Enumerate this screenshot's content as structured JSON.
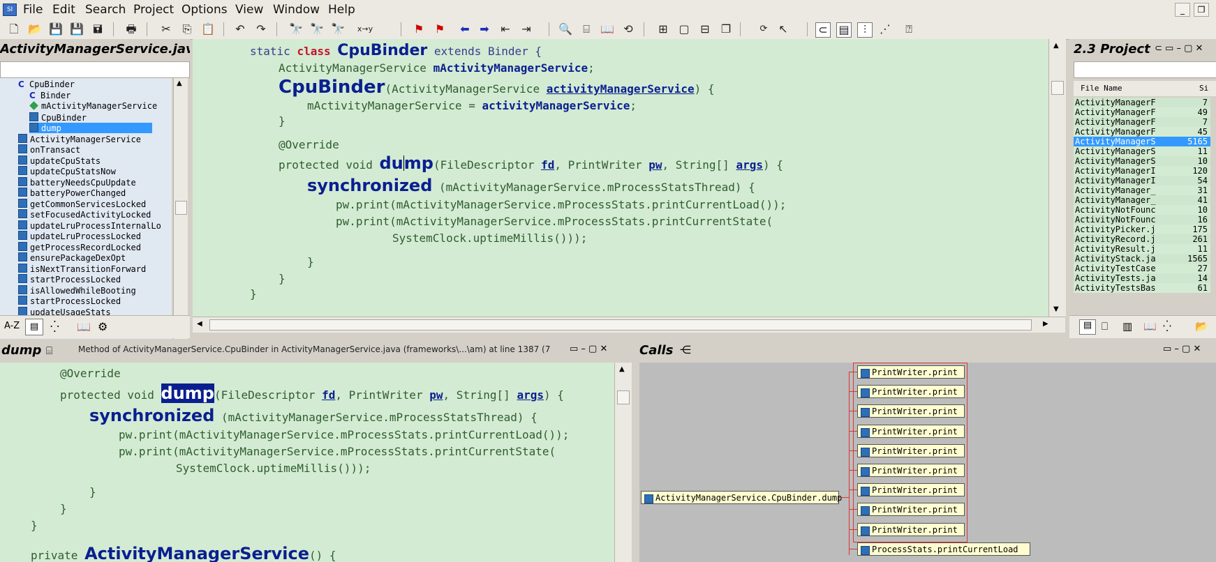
{
  "menubar": {
    "items": [
      "File",
      "Edit",
      "Search",
      "Project",
      "Options",
      "View",
      "Window",
      "Help"
    ]
  },
  "symbol_panel": {
    "title": "ActivityManagerService.java",
    "tree": [
      {
        "label": "CpuBinder",
        "icon": "class-icon",
        "indent": 1
      },
      {
        "label": "Binder",
        "icon": "class-icon",
        "indent": 2
      },
      {
        "label": "mActivityManagerService",
        "icon": "field-icon",
        "indent": 2
      },
      {
        "label": "CpuBinder",
        "icon": "method-icon",
        "indent": 2
      },
      {
        "label": "dump",
        "icon": "method-icon",
        "indent": 2,
        "selected": true
      },
      {
        "label": "ActivityManagerService",
        "icon": "method-icon",
        "indent": 1
      },
      {
        "label": "onTransact",
        "icon": "method-icon",
        "indent": 1
      },
      {
        "label": "updateCpuStats",
        "icon": "method-icon",
        "indent": 1
      },
      {
        "label": "updateCpuStatsNow",
        "icon": "method-icon",
        "indent": 1
      },
      {
        "label": "batteryNeedsCpuUpdate",
        "icon": "method-icon",
        "indent": 1
      },
      {
        "label": "batteryPowerChanged",
        "icon": "method-icon",
        "indent": 1
      },
      {
        "label": "getCommonServicesLocked",
        "icon": "method-icon",
        "indent": 1
      },
      {
        "label": "setFocusedActivityLocked",
        "icon": "method-icon",
        "indent": 1
      },
      {
        "label": "updateLruProcessInternalLo",
        "icon": "method-icon",
        "indent": 1
      },
      {
        "label": "updateLruProcessLocked",
        "icon": "method-icon",
        "indent": 1
      },
      {
        "label": "getProcessRecordLocked",
        "icon": "method-icon",
        "indent": 1
      },
      {
        "label": "ensurePackageDexOpt",
        "icon": "method-icon",
        "indent": 1
      },
      {
        "label": "isNextTransitionForward",
        "icon": "method-icon",
        "indent": 1
      },
      {
        "label": "startProcessLocked",
        "icon": "method-icon",
        "indent": 1
      },
      {
        "label": "isAllowedWhileBooting",
        "icon": "method-icon",
        "indent": 1
      },
      {
        "label": "startProcessLocked",
        "icon": "method-icon",
        "indent": 1
      },
      {
        "label": "updateUsageStats",
        "icon": "method-icon",
        "indent": 1
      }
    ],
    "sort_label": "A-Z"
  },
  "editor": {
    "lines": {
      "l1_static": "static ",
      "l1_class": "class ",
      "l1_name": "CpuBinder",
      "l1_rest": " extends Binder {",
      "l2_type": "ActivityManagerService ",
      "l2_field": "mActivityManagerService",
      "l2_semi": ";",
      "l3_name": "CpuBinder",
      "l3_open": "(ActivityManagerService ",
      "l3_param": "activityManagerService",
      "l3_close": ") {",
      "l4_lhs": "mActivityManagerService = ",
      "l4_rhs": "activityManagerService",
      "l4_semi": ";",
      "l5": "}",
      "l6": "@Override",
      "l7_mod": "protected void ",
      "l7_name_a": "du",
      "l7_name_b": "mp",
      "l7_p1": "(FileDescriptor ",
      "l7_fd": "fd",
      "l7_p2": ", PrintWriter ",
      "l7_pw": "pw",
      "l7_p3": ", String[] ",
      "l7_args": "args",
      "l7_p4": ") {",
      "l8_sync": "synchronized",
      "l8_rest": " (mActivityManagerService.mProcessStatsThread) {",
      "l9": "pw.print(mActivityManagerService.mProcessStats.printCurrentLoad());",
      "l10": "pw.print(mActivityManagerService.mProcessStats.printCurrentState(",
      "l11": "SystemClock.uptimeMillis()));",
      "l12": "}",
      "l13": "}",
      "l14": "}"
    }
  },
  "project_panel": {
    "title": "2.3 Project",
    "col_name": "File Name",
    "col_size": "Si",
    "files": [
      {
        "name": "ActivityManagerF",
        "size": "7"
      },
      {
        "name": "ActivityManagerF",
        "size": "49"
      },
      {
        "name": "ActivityManagerF",
        "size": "7"
      },
      {
        "name": "ActivityManagerF",
        "size": "45"
      },
      {
        "name": "ActivityManagerS",
        "size": "5165",
        "selected": true
      },
      {
        "name": "ActivityManagerS",
        "size": "11"
      },
      {
        "name": "ActivityManagerS",
        "size": "10"
      },
      {
        "name": "ActivityManagerI",
        "size": "120"
      },
      {
        "name": "ActivityManagerI",
        "size": "54"
      },
      {
        "name": "ActivityManager_",
        "size": "31"
      },
      {
        "name": "ActivityManager_",
        "size": "41"
      },
      {
        "name": "ActivityNotFounc",
        "size": "10"
      },
      {
        "name": "ActivityNotFounc",
        "size": "16"
      },
      {
        "name": "ActivityPicker.j",
        "size": "175"
      },
      {
        "name": "ActivityRecord.j",
        "size": "261"
      },
      {
        "name": "ActivityResult.j",
        "size": "11"
      },
      {
        "name": "ActivityStack.ja",
        "size": "1565"
      },
      {
        "name": "ActivityTestCase",
        "size": "27"
      },
      {
        "name": "ActivityTests.ja",
        "size": "14"
      },
      {
        "name": "ActivityTestsBas",
        "size": "61"
      }
    ]
  },
  "context_panel": {
    "title": "dump",
    "info": "Method of ActivityManagerService.CpuBinder in ActivityManagerService.java (frameworks\\...\\am) at line 1387 (7",
    "lines": {
      "l1": "@Override",
      "l2_mod": "protected void ",
      "l2_name": "dump",
      "l2_p1": "(FileDescriptor ",
      "l2_fd": "fd",
      "l2_p2": ", PrintWriter ",
      "l2_pw": "pw",
      "l2_p3": ", String[] ",
      "l2_args": "args",
      "l2_p4": ") {",
      "l3_sync": "synchronized",
      "l3_rest": " (mActivityManagerService.mProcessStatsThread) {",
      "l4": "pw.print(mActivityManagerService.mProcessStats.printCurrentLoad());",
      "l5": "pw.print(mActivityManagerService.mProcessStats.printCurrentState(",
      "l6": "SystemClock.uptimeMillis()));",
      "l7": "}",
      "l8": "}",
      "l9": "}",
      "l10_mod": "private ",
      "l10_name": "ActivityManagerService",
      "l10_rest": "() {"
    }
  },
  "calls_panel": {
    "title": "Calls",
    "root": "ActivityManagerService.CpuBinder.dump",
    "callees": [
      "PrintWriter.print",
      "PrintWriter.print",
      "PrintWriter.print",
      "PrintWriter.print",
      "PrintWriter.print",
      "PrintWriter.print",
      "PrintWriter.print",
      "PrintWriter.print",
      "PrintWriter.print",
      "ProcessStats.printCurrentLoad"
    ]
  },
  "colors": {
    "code_bg": "#d3ebd3",
    "selection": "#3399ff",
    "keyword_red": "#c8102e",
    "identifier": "#0a1f8f"
  }
}
